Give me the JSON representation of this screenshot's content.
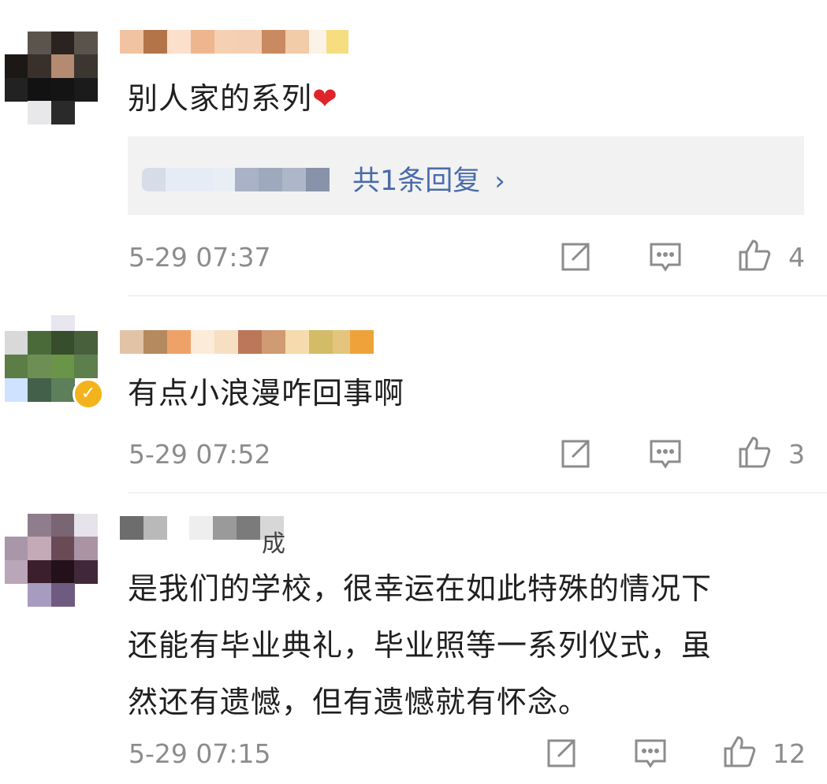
{
  "comments": [
    {
      "text": "别人家的系列",
      "heart": "❤",
      "reply_link": "共1条回复",
      "reply_chevron": "›",
      "time": "5-29 07:37",
      "likes": "4",
      "icons": [
        "share-icon",
        "comment-icon",
        "like-icon"
      ]
    },
    {
      "text": "有点小浪漫咋回事啊",
      "verified_mark": "✓",
      "time": "5-29 07:52",
      "likes": "3",
      "icons": [
        "share-icon",
        "comment-icon",
        "like-icon"
      ]
    },
    {
      "username_suffix": "成",
      "text_lines": [
        "是我们的学校，很幸运在如此特殊的情况下",
        "还能有毕业典礼，毕业照等一系列仪式，虽",
        "然还有遗憾，但有遗憾就有怀念。"
      ],
      "time": "5-29 07:15",
      "likes": "12",
      "icons": [
        "share-icon",
        "comment-icon",
        "like-icon"
      ]
    }
  ],
  "colors": {
    "link": "#4a6bab",
    "meta": "#8c8c8c",
    "heart": "#e0242b",
    "verified": "#f3b31c"
  }
}
